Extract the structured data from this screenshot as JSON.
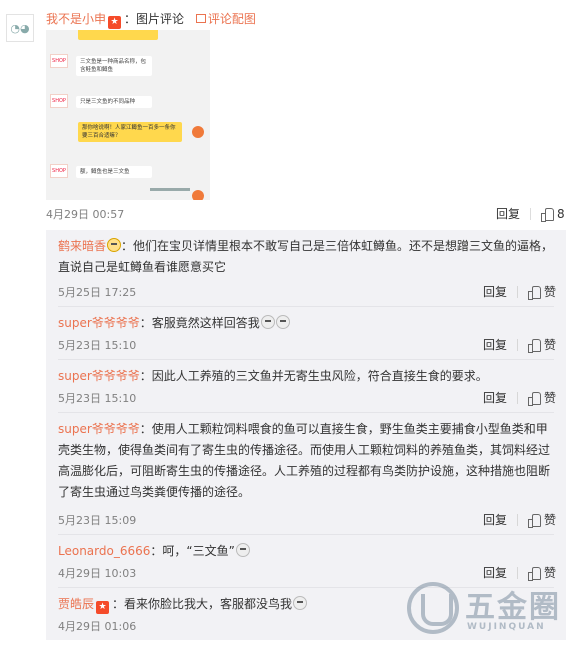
{
  "post": {
    "author": "我不是小申",
    "vip_badge": "★",
    "label_sep": "：",
    "label": "图片评论",
    "album_link": "评论配图",
    "time": "4月29日 00:57",
    "reply": "回复",
    "likes": "8"
  },
  "screenshot": {
    "bubbles": [
      {
        "text": "三文鱼是一种商品名称，包含鲑鱼和鳟鱼",
        "side": "left"
      },
      {
        "text": "只是三文鱼的不同品种",
        "side": "left"
      },
      {
        "text": "那你啥说啊！人家江鳟鱼一百多一条你要三百合适嘛？",
        "side": "right"
      },
      {
        "text": "额，鳟鱼也是三文鱼",
        "side": "left"
      }
    ],
    "avatar_text": "SHOP"
  },
  "comments": [
    {
      "name": "鹤来暗香",
      "has_emoji_after_name": true,
      "text": "：他们在宝贝详情里根本不敢写自己是三倍体虹鳟鱼。还不是想蹭三文鱼的逼格，直说自己是虹鳟鱼看谁愿意买它",
      "date": "5月25日 17:25",
      "reply": "回复",
      "like": "赞"
    },
    {
      "name": "super爷爷爷爷",
      "text": "：客服竟然这样回答我",
      "date": "5月23日 15:10",
      "reply": "回复",
      "like": "赞"
    },
    {
      "name": "super爷爷爷爷",
      "text": "：因此人工养殖的三文鱼并无寄生虫风险，符合直接生食的要求。",
      "date": "5月23日 15:10",
      "reply": "回复",
      "like": "赞"
    },
    {
      "name": "super爷爷爷爷",
      "text": "：使用人工颗粒饲料喂食的鱼可以直接生食，野生鱼类主要捕食小型鱼类和甲壳类生物，使得鱼类间有了寄生虫的传播途径。而使用人工颗粒饲料的养殖鱼类，其饲料经过高温膨化后，可阻断寄生虫的传播途径。人工养殖的过程都有鸟类防护设施，这种措施也阻断了寄生虫通过鸟类粪便传播的途径。",
      "date": "5月23日 15:09",
      "reply": "回复",
      "like": "赞"
    },
    {
      "name": "Leonardo_6666",
      "text": "：呵，“三文鱼”",
      "date": "4月29日 10:03",
      "reply": "回复",
      "like": "赞"
    },
    {
      "name": "贾皓辰",
      "vip": true,
      "text": "：看来你脸比我大，客服都没鸟我",
      "date": "4月29日 01:06",
      "reply": "回复",
      "like": "赞"
    }
  ],
  "watermark": {
    "title": "五金圈",
    "sub": "WUJINQUAN"
  },
  "colors": {
    "accent": "#eb7350",
    "panel": "#f2f2f5",
    "bubble_highlight": "#ffd84d"
  }
}
